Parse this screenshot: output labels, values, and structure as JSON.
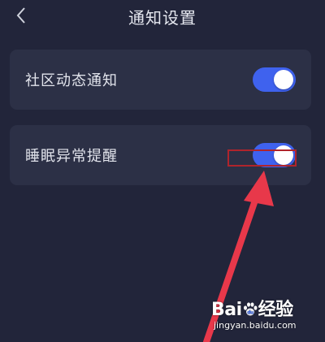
{
  "header": {
    "title": "通知设置",
    "back_icon": "chevron-left-icon"
  },
  "settings": [
    {
      "label": "社区动态通知",
      "enabled": true
    },
    {
      "label": "睡眠异常提醒",
      "enabled": true
    }
  ],
  "colors": {
    "background": "#22253a",
    "card": "#2c3046",
    "toggle_on": "#3f62ee",
    "annotation": "#e8384a",
    "highlight_border": "#b0242c"
  },
  "watermark": {
    "brand_a": "Bai",
    "brand_b": "经验",
    "site": "jingyan.baidu.com"
  }
}
